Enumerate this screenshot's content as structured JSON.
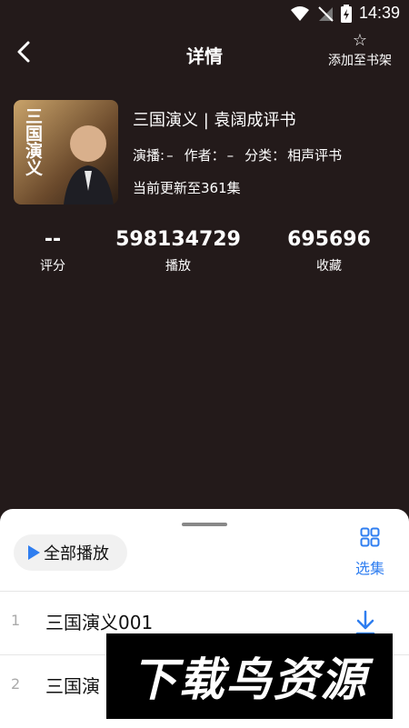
{
  "status": {
    "time": "14:39"
  },
  "header": {
    "title": "详情",
    "back_icon": "chevron-left-icon",
    "add_to_shelf_label": "添加至书架",
    "star_glyph": "☆"
  },
  "book": {
    "title": "三国演义 | 袁阔成评书",
    "narrator_label": "演播:",
    "narrator_value": "–",
    "author_label": "作者：",
    "author_value": "–",
    "category_label": "分类：",
    "category_value": "相声评书",
    "updated": "当前更新至361集",
    "cover_text": "三国演义"
  },
  "stats": [
    {
      "value": "--",
      "label": "评分"
    },
    {
      "value": "598134729",
      "label": "播放"
    },
    {
      "value": "695696",
      "label": "收藏"
    }
  ],
  "sheet": {
    "play_all": "全部播放",
    "select_episodes": "选集",
    "episodes": [
      {
        "index": "1",
        "name": "三国演义001"
      },
      {
        "index": "2",
        "name": "三国演"
      }
    ]
  },
  "watermark": "下载鸟资源",
  "colors": {
    "accent": "#2f7ef0",
    "background": "#231a1a"
  }
}
